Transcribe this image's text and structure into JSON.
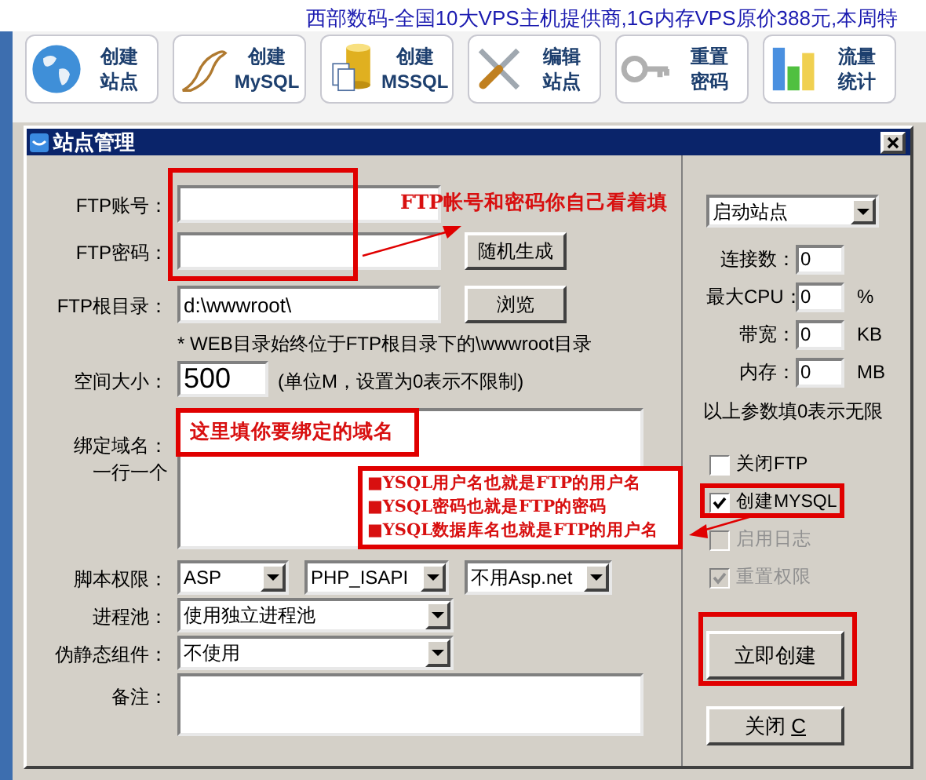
{
  "banner": {
    "text": "西部数码-全国10大VPS主机提供商,1G内存VPS原价388元,本周特"
  },
  "toolbar": [
    {
      "lines": [
        "创建",
        "站点"
      ]
    },
    {
      "lines": [
        "创建",
        "MySQL"
      ]
    },
    {
      "lines": [
        "创建",
        "MSSQL"
      ]
    },
    {
      "lines": [
        "编辑",
        "站点"
      ]
    },
    {
      "lines": [
        "重置",
        "密码"
      ]
    },
    {
      "lines": [
        "流量",
        "统计"
      ]
    }
  ],
  "dialog": {
    "title": "站点管理",
    "fields": [
      {
        "kind": "input",
        "label": "FTP账号："
      },
      {
        "kind": "input",
        "label": "FTP密码：",
        "button": "随机生成"
      },
      {
        "kind": "input",
        "label": "FTP根目录：",
        "value": "d:\\wwwroot\\",
        "button": "浏览"
      },
      {
        "kind": "note",
        "text": "* WEB目录始终位于FTP根目录下的\\wwwroot目录"
      },
      {
        "kind": "size",
        "label": "空间大小：",
        "value": "500",
        "hint": "(单位M，设置为0表示不限制)"
      },
      {
        "kind": "textarea",
        "label_lines": [
          "绑定域名：",
          "一行一个"
        ]
      },
      {
        "kind": "selects",
        "label": "脚本权限：",
        "values": [
          "ASP",
          "PHP_ISAPI",
          "不用Asp.net"
        ]
      },
      {
        "kind": "select",
        "label": "进程池：",
        "value": "使用独立进程池"
      },
      {
        "kind": "select",
        "label": "伪静态组件：",
        "value": "不使用"
      },
      {
        "kind": "memo",
        "label": "备注："
      }
    ],
    "status_select": "启动站点",
    "limits": [
      {
        "label": "连接数：",
        "value": "0"
      },
      {
        "label": "最大CPU：",
        "value": "0",
        "unit": "%"
      },
      {
        "label": "带宽：",
        "value": "0",
        "unit": "KB"
      },
      {
        "label": "内存：",
        "value": "0",
        "unit": "MB"
      }
    ],
    "limits_note": "以上参数填0表示无限",
    "options": [
      {
        "label": "关闭FTP",
        "checked": false,
        "disabled": false
      },
      {
        "label": "创建MYSQL",
        "checked": true,
        "disabled": false
      },
      {
        "label": "启用日志",
        "checked": false,
        "disabled": true
      },
      {
        "label": "重置权限",
        "checked": true,
        "disabled": true
      }
    ],
    "create_button": "立即创建",
    "close_button": {
      "label": "关闭 ",
      "accesskey": "C"
    }
  },
  "annotations": {
    "ftp_note": "FTP帐号和密码你自己看着填",
    "domain_note": "这里填你要绑定的域名",
    "mysql_notes": [
      "■YSQL用户名也就是FTP的用户名",
      "■YSQL密码也就是FTP的密码",
      "■YSQL数据库名也就是FTP的用户名"
    ]
  }
}
